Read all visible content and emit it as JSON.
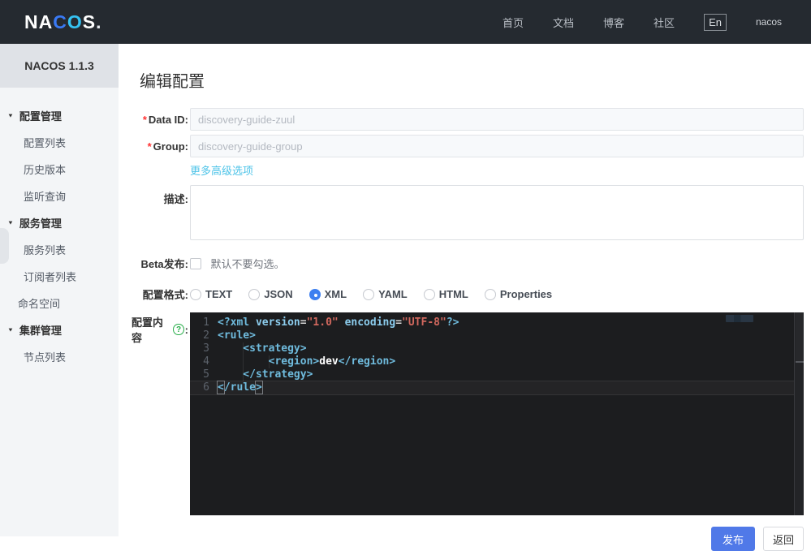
{
  "navbar": {
    "logo": {
      "na": "NA",
      "c": "C",
      "o": "O",
      "s": "S",
      "dot": "."
    },
    "items": [
      "首页",
      "文档",
      "博客",
      "社区"
    ],
    "lang": "En",
    "user": "nacos"
  },
  "sidebar": {
    "version": "NACOS 1.1.3",
    "items": [
      {
        "label": "配置管理"
      },
      {
        "label": "配置列表"
      },
      {
        "label": "历史版本"
      },
      {
        "label": "监听查询"
      },
      {
        "label": "服务管理"
      },
      {
        "label": "服务列表"
      },
      {
        "label": "订阅者列表"
      },
      {
        "label": "命名空间"
      },
      {
        "label": "集群管理"
      },
      {
        "label": "节点列表"
      }
    ]
  },
  "page": {
    "title": "编辑配置"
  },
  "form": {
    "data_id": {
      "required": "*",
      "label": "Data ID:",
      "value": "discovery-guide-zuul"
    },
    "group": {
      "required": "*",
      "label": "Group:",
      "value": "discovery-guide-group"
    },
    "advanced_link": "更多高级选项",
    "description": {
      "label": "描述:"
    },
    "beta": {
      "label": "Beta发布:",
      "hint": "默认不要勾选。"
    },
    "format": {
      "label": "配置格式:",
      "options": [
        "TEXT",
        "JSON",
        "XML",
        "YAML",
        "HTML",
        "Properties"
      ],
      "selected": "XML"
    },
    "content": {
      "label": "配置内容",
      "help": "?",
      "colon": ":"
    }
  },
  "editor": {
    "lines": [
      {
        "no": "1",
        "t1": "<?xml",
        "sp1": " ",
        "a1": "version",
        "eq1": "=",
        "s1": "\"1.0\"",
        "sp2": " ",
        "a2": "encoding",
        "eq2": "=",
        "s2": "\"UTF-8\"",
        "t2": "?>"
      },
      {
        "no": "2",
        "t1": "<rule>"
      },
      {
        "no": "3",
        "t1": "    <strategy>"
      },
      {
        "no": "4",
        "pre": "        ",
        "t1": "<region>",
        "txt": "dev",
        "t2": "</region>"
      },
      {
        "no": "5",
        "t1": "    </strategy>"
      },
      {
        "no": "6",
        "b1": "<",
        "t1": "/rule",
        "b2": ">"
      }
    ]
  },
  "actions": {
    "publish": "发布",
    "back": "返回"
  },
  "colors": {
    "accent_blue": "#5079e8",
    "radio_blue": "#3d7ff0",
    "link_cyan": "#4cc3e8",
    "help_green": "#27ad49",
    "navbar_bg": "#252a30",
    "editor_bg": "#1c1d1f"
  }
}
